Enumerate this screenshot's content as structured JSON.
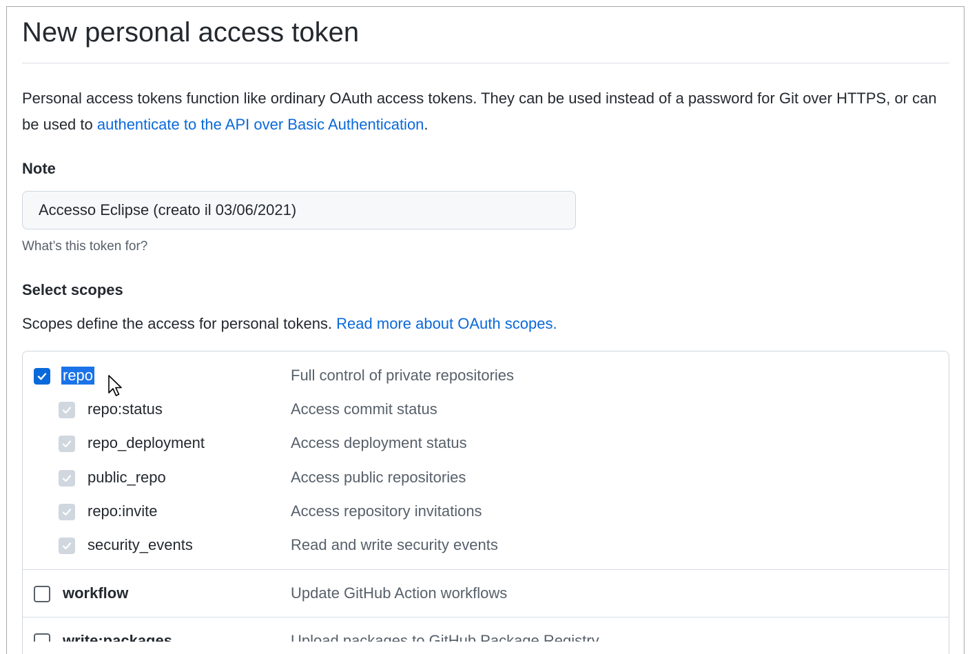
{
  "page": {
    "title": "New personal access token",
    "intro_text": "Personal access tokens function like ordinary OAuth access tokens. They can be used instead of a password for Git over HTTPS, or can be used to ",
    "intro_link": "authenticate to the API over Basic Authentication",
    "intro_end": "."
  },
  "note": {
    "label": "Note",
    "value": "Accesso Eclipse (creato il 03/06/2021)",
    "hint": "What’s this token for?"
  },
  "scopes": {
    "label": "Select scopes",
    "description": "Scopes define the access for personal tokens. ",
    "link": "Read more about OAuth scopes.",
    "repo": {
      "name": "repo",
      "description": "Full control of private repositories",
      "checked": true
    },
    "repo_children": [
      {
        "name": "repo:status",
        "description": "Access commit status"
      },
      {
        "name": "repo_deployment",
        "description": "Access deployment status"
      },
      {
        "name": "public_repo",
        "description": "Access public repositories"
      },
      {
        "name": "repo:invite",
        "description": "Access repository invitations"
      },
      {
        "name": "security_events",
        "description": "Read and write security events"
      }
    ],
    "workflow": {
      "name": "workflow",
      "description": "Update GitHub Action workflows",
      "checked": false
    },
    "write_packages": {
      "name": "write:packages",
      "description": "Upload packages to GitHub Package Registry",
      "checked": false
    }
  },
  "colors": {
    "link": "#0969da",
    "checkbox_checked": "#0969da",
    "checkbox_disabled": "#d0d7de",
    "selection": "#1a73e8",
    "text": "#24292f",
    "muted": "#57606a"
  },
  "icons": {
    "check": "check-icon",
    "cursor": "mouse-pointer-icon"
  }
}
